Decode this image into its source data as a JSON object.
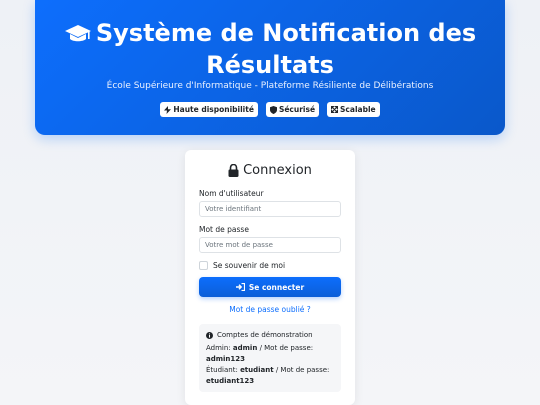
{
  "header": {
    "title": "Système de Notification des Résultats",
    "subtitle": "École Supérieure d'Informatique - Plateforme Résiliente de Délibérations",
    "badges": [
      {
        "icon": "bolt-icon",
        "label": "Haute disponibilité"
      },
      {
        "icon": "shield-icon",
        "label": "Sécurisé"
      },
      {
        "icon": "expand-arrows-icon",
        "label": "Scalable"
      }
    ]
  },
  "login": {
    "title": "Connexion",
    "username_label": "Nom d'utilisateur",
    "username_placeholder": "Votre identifiant",
    "username_value": "",
    "password_label": "Mot de passe",
    "password_placeholder": "Votre mot de passe",
    "password_value": "",
    "remember_label": "Se souvenir de moi",
    "remember_checked": false,
    "submit_label": "Se connecter",
    "forgot_label": "Mot de passe oublié ?"
  },
  "demo": {
    "title": "Comptes de démonstration",
    "admin_prefix": "Admin:",
    "admin_user": "admin",
    "admin_sep": "/ Mot de passe:",
    "admin_pass": "admin123",
    "student_prefix": "Étudiant:",
    "student_user": "etudiant",
    "student_sep": "/ Mot de passe:",
    "student_pass": "etudiant123"
  },
  "colors": {
    "primary": "#0d6efd",
    "primary_dark": "#0a58ca",
    "background": "#f0f2f5"
  }
}
